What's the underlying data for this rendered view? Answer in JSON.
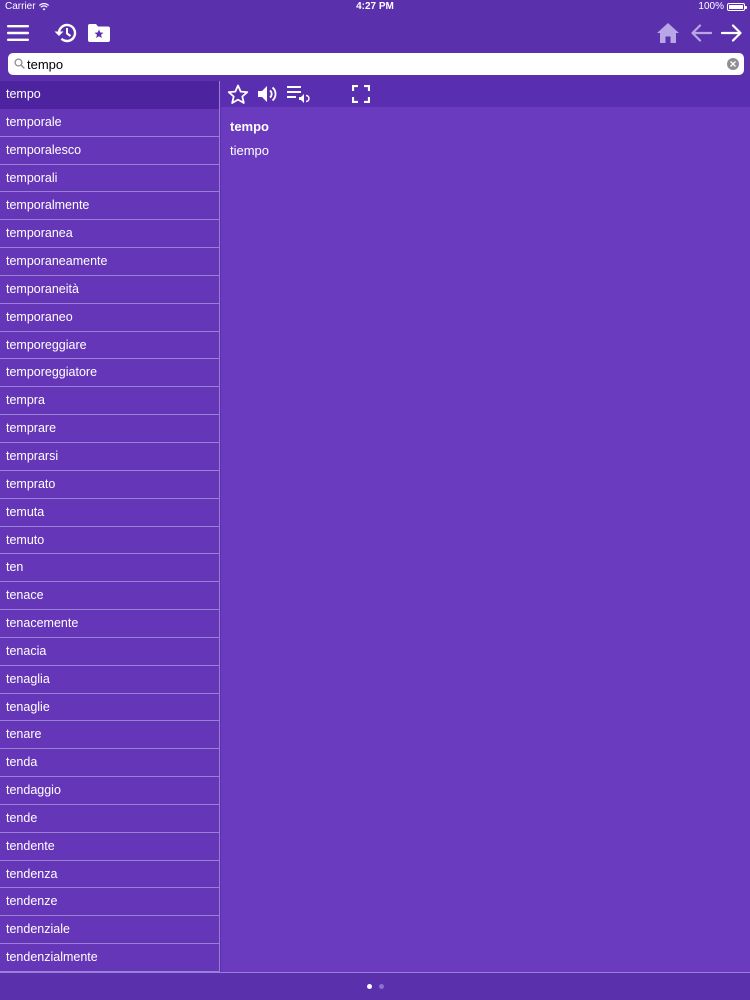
{
  "status_bar": {
    "carrier": "Carrier",
    "time": "4:27 PM",
    "battery": "100%"
  },
  "toolbar": {
    "icons": [
      "menu-icon",
      "history-icon",
      "favorites-folder-icon",
      "home-icon",
      "back-arrow-icon",
      "forward-arrow-icon"
    ]
  },
  "search": {
    "value": "tempo",
    "placeholder": ""
  },
  "word_list": {
    "selected_index": 0,
    "items": [
      "tempo",
      "temporale",
      "temporalesco",
      "temporali",
      "temporalmente",
      "temporanea",
      "temporaneamente",
      "temporaneità",
      "temporaneo",
      "temporeggiare",
      "temporeggiatore",
      "tempra",
      "temprare",
      "temprarsi",
      "temprato",
      "temuta",
      "temuto",
      "ten",
      "tenace",
      "tenacemente",
      "tenacia",
      "tenaglia",
      "tenaglie",
      "tenare",
      "tenda",
      "tendaggio",
      "tende",
      "tendente",
      "tendenza",
      "tendenze",
      "tendenziale",
      "tendenzialmente"
    ]
  },
  "detail": {
    "headword": "tempo",
    "translation": "tiempo",
    "toolbar_icons": [
      "star-icon",
      "speaker-icon",
      "playlist-speaker-icon",
      "fullscreen-icon"
    ]
  },
  "pager": {
    "pages": 2,
    "current": 0
  },
  "colors": {
    "background": "#5a30ad",
    "list_bg": "#6636b9",
    "selected": "#4d23a0",
    "detail_bg": "#6a3bbf",
    "text": "#ffffff"
  }
}
